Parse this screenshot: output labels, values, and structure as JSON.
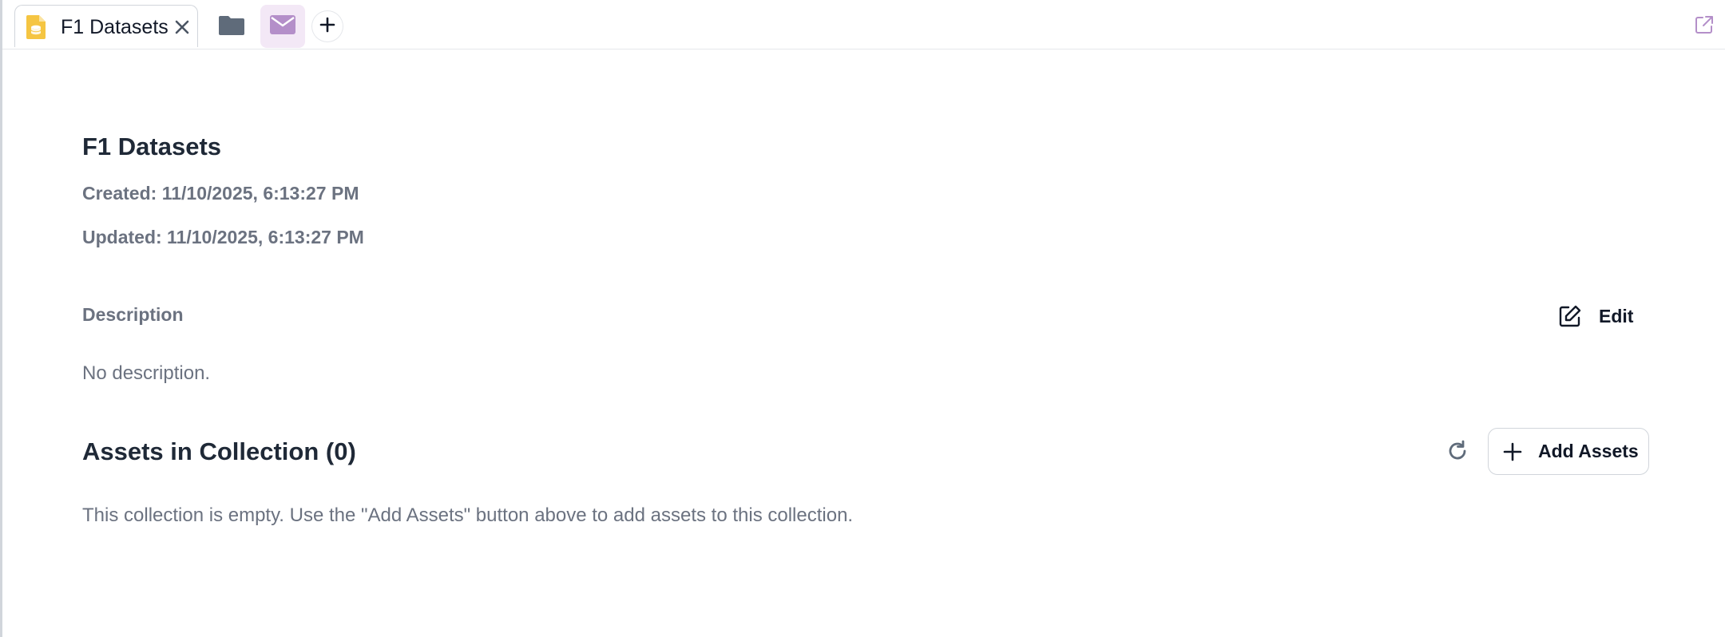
{
  "tabs": [
    {
      "label": "F1 Datasets",
      "icon": "database-file-icon",
      "active": true
    }
  ],
  "toolbar": {
    "folder_icon": "folder-icon",
    "mail_icon": "mail-icon",
    "new_tab_icon": "plus-icon",
    "popout_icon": "external-link-icon"
  },
  "collection": {
    "title": "F1 Datasets",
    "created": "Created: 11/10/2025, 6:13:27 PM",
    "updated": "Updated: 11/10/2025, 6:13:27 PM"
  },
  "description": {
    "label": "Description",
    "edit_label": "Edit",
    "text": "No description."
  },
  "assets": {
    "title": "Assets in Collection (0)",
    "add_label": "Add Assets",
    "empty_text": "This collection is empty. Use the \"Add Assets\" button above to add assets to this collection."
  },
  "colors": {
    "accent_purple": "#b48fc9",
    "tab_icon_yellow": "#f5c542",
    "muted_text": "#6b7280",
    "heading_text": "#1f2937"
  }
}
